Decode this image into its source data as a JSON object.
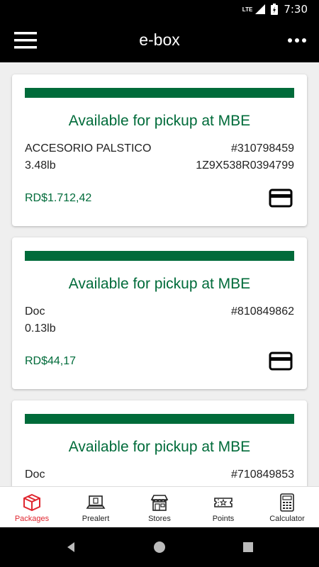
{
  "status_bar": {
    "network": "LTE",
    "time": "7:30"
  },
  "app_bar": {
    "title": "e-box",
    "menu_icon": "hamburger-menu-icon",
    "more_icon": "more-options-icon"
  },
  "packages": [
    {
      "status": "Available for pickup at MBE",
      "description": "ACCESORIO PALSTICO",
      "number": "#310798459",
      "weight": "3.48lb",
      "tracking": "1Z9X538R0394799",
      "price": "RD$1.712,42"
    },
    {
      "status": "Available for pickup at MBE",
      "description": "Doc",
      "number": "#810849862",
      "weight": "0.13lb",
      "tracking": "",
      "price": "RD$44,17"
    },
    {
      "status": "Available for pickup at MBE",
      "description": "Doc",
      "number": "#710849853",
      "weight": "",
      "tracking": "",
      "price": ""
    }
  ],
  "bottom_nav": [
    {
      "label": "Packages",
      "icon": "package-icon",
      "active": true
    },
    {
      "label": "Prealert",
      "icon": "laptop-icon",
      "active": false
    },
    {
      "label": "Stores",
      "icon": "store-icon",
      "active": false
    },
    {
      "label": "Points",
      "icon": "ticket-icon",
      "active": false
    },
    {
      "label": "Calculator",
      "icon": "calculator-icon",
      "active": false
    }
  ],
  "colors": {
    "accent": "#006b3a",
    "active_nav": "#e0262f",
    "app_bar": "#000000"
  }
}
